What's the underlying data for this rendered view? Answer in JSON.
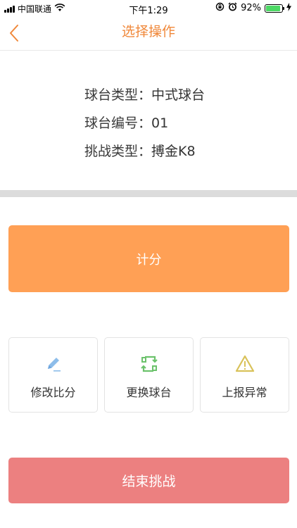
{
  "status_bar": {
    "carrier": "中国联通",
    "time": "下午1:29",
    "battery": "92%",
    "battery_level": 0.92,
    "battery_color": "#4cd964"
  },
  "nav": {
    "title": "选择操作",
    "back_icon": "chevron-left-icon",
    "accent_color": "#f0883a"
  },
  "info": {
    "table_type_label": "球台类型：",
    "table_type_value": "中式球台",
    "table_number_label": "球台编号：",
    "table_number_value": "01",
    "challenge_type_label": "挑战类型：",
    "challenge_type_value": "搏金K8"
  },
  "actions": {
    "score_label": "计分",
    "score_color": "#ffa055",
    "cards": [
      {
        "label": "修改比分",
        "icon": "pencil-icon",
        "color": "#7ab3e6"
      },
      {
        "label": "更换球台",
        "icon": "swap-icon",
        "color": "#6cc26c"
      },
      {
        "label": "上报异常",
        "icon": "warning-icon",
        "color": "#d9c25a"
      }
    ],
    "end_label": "结束挑战",
    "end_color": "#ec8080"
  }
}
